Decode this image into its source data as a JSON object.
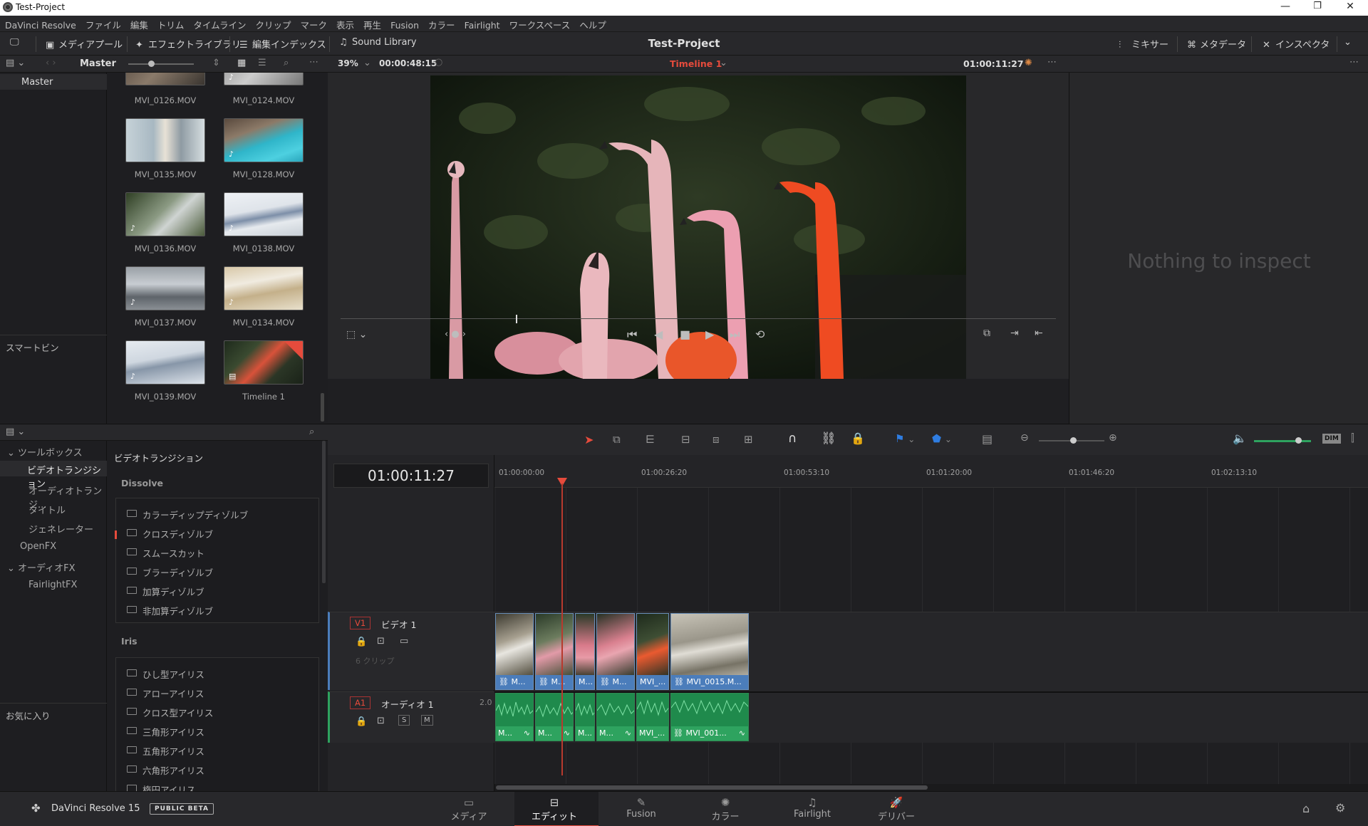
{
  "window": {
    "title": "Test-Project",
    "controls": [
      "—",
      "❐",
      "✕"
    ]
  },
  "menu": [
    "DaVinci Resolve",
    "ファイル",
    "編集",
    "トリム",
    "タイムライン",
    "クリップ",
    "マーク",
    "表示",
    "再生",
    "Fusion",
    "カラー",
    "Fairlight",
    "ワークスペース",
    "ヘルプ"
  ],
  "toolbar": {
    "media_pool": "メディアプール",
    "effects_library": "エフェクトライブラリ",
    "edit_index": "編集インデックス",
    "sound_library": "Sound Library",
    "project_title": "Test-Project",
    "mixer": "ミキサー",
    "metadata": "メタデータ",
    "inspector": "インスペクタ"
  },
  "media_pool": {
    "bin_title": "Master",
    "bins": [
      "Master"
    ],
    "smart_bins": "スマートビン",
    "clips": [
      {
        "name": "MVI_0126.MOV"
      },
      {
        "name": "MVI_0124.MOV"
      },
      {
        "name": "MVI_0135.MOV"
      },
      {
        "name": "MVI_0128.MOV"
      },
      {
        "name": "MVI_0136.MOV"
      },
      {
        "name": "MVI_0138.MOV"
      },
      {
        "name": "MVI_0137.MOV"
      },
      {
        "name": "MVI_0134.MOV"
      },
      {
        "name": "MVI_0139.MOV"
      },
      {
        "name": "Timeline 1"
      }
    ]
  },
  "effects": {
    "tree": {
      "toolbox": "ツールボックス",
      "video_transitions": "ビデオトランジション",
      "audio_transitions": "オーディオトランジ...",
      "titles": "タイトル",
      "generators": "ジェネレーター",
      "openfx": "OpenFX",
      "audiofx": "オーディオFX",
      "fairlightfx": "FairlightFX",
      "favorites": "お気に入り"
    },
    "header": "ビデオトランジション",
    "groups": [
      {
        "name": "Dissolve",
        "items": [
          "カラーディップディゾルブ",
          "クロスディゾルブ",
          "スムースカット",
          "ブラーディゾルブ",
          "加算ディゾルブ",
          "非加算ディゾルブ"
        ]
      },
      {
        "name": "Iris",
        "items": [
          "ひし型アイリス",
          "アローアイリス",
          "クロス型アイリス",
          "三角形アイリス",
          "五角形アイリス",
          "六角形アイリス",
          "楕円アイリス"
        ]
      }
    ]
  },
  "viewer": {
    "zoom": "39%",
    "duration": "00:00:48:15",
    "timeline_name": "Timeline 1",
    "timecode": "01:00:11:27",
    "nav_label": "‹ ● ›"
  },
  "inspector": {
    "empty_text": "Nothing to inspect"
  },
  "timeline": {
    "current_timecode": "01:00:11:27",
    "ruler": [
      "01:00:00:00",
      "01:00:26:20",
      "01:00:53:10",
      "01:01:20:00",
      "01:01:46:20",
      "01:02:13:10"
    ],
    "video_track": {
      "id": "V1",
      "name": "ビデオ 1",
      "clip_count": "6 クリップ"
    },
    "audio_track": {
      "id": "A1",
      "name": "オーディオ 1",
      "channels": "2.0",
      "solo": "S",
      "mute": "M"
    },
    "video_clips": [
      "M...",
      "M...",
      "M...",
      "M...",
      "MVI_...",
      "MVI_0015.M..."
    ],
    "audio_clips": [
      "M...",
      "M...",
      "M...",
      "M...",
      "MVI_...",
      "MVI_001..."
    ],
    "dim_label": "DIM"
  },
  "bottom": {
    "app_name": "DaVinci Resolve 15",
    "badge": "PUBLIC BETA",
    "pages": [
      "メディア",
      "エディット",
      "Fusion",
      "カラー",
      "Fairlight",
      "デリバー"
    ],
    "active_page": "エディット"
  },
  "colors": {
    "accent_red": "#e64b3c",
    "video_clip": "#4b7dbb",
    "audio_clip": "#2ea35f",
    "playhead": "#e64b3c"
  }
}
